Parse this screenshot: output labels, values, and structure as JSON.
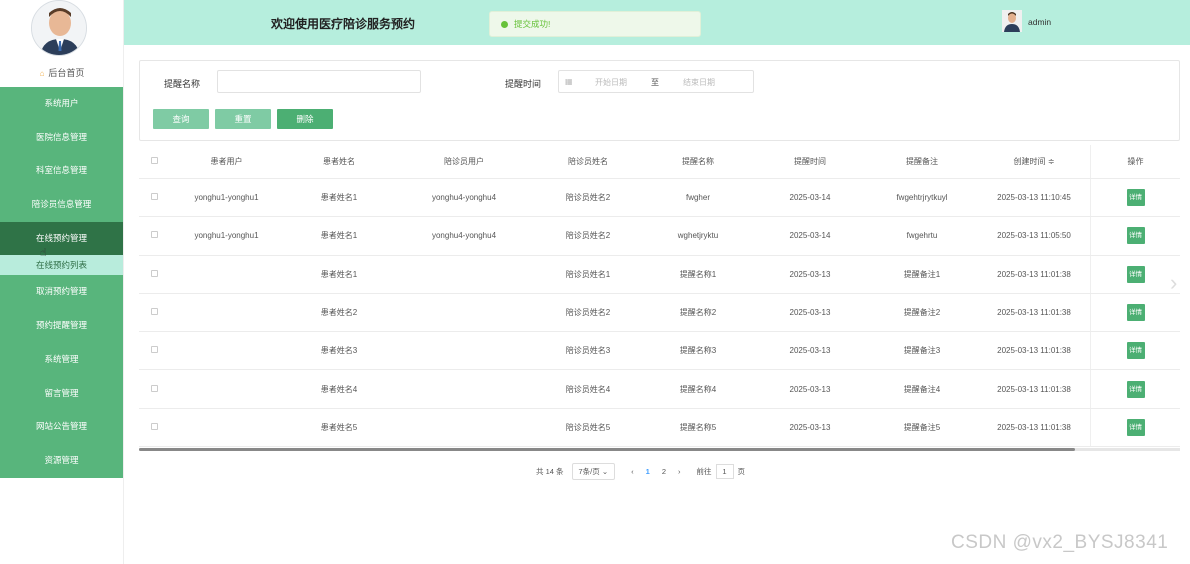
{
  "sidebar": {
    "home_label": "后台首页",
    "menu": [
      {
        "label": "系统用户"
      },
      {
        "label": "医院信息管理"
      },
      {
        "label": "科室信息管理"
      },
      {
        "label": "陪诊员信息管理"
      },
      {
        "label": "在线预约管理"
      },
      {
        "label": "取消预约管理"
      },
      {
        "label": "预约提醒管理"
      },
      {
        "label": "系统管理"
      },
      {
        "label": "留言管理"
      },
      {
        "label": "网站公告管理"
      },
      {
        "label": "资源管理"
      }
    ],
    "submenu_active": "在线预约列表"
  },
  "header": {
    "title": "欢迎使用医疗陪诊服务预约",
    "toast": "提交成功!",
    "username": "admin"
  },
  "search": {
    "name_label": "提醒名称",
    "time_label": "提醒时间",
    "start_placeholder": "开始日期",
    "to_label": "至",
    "end_placeholder": "结束日期",
    "query_btn": "查询",
    "reset_btn": "重置",
    "delete_btn": "删除"
  },
  "table": {
    "headers": [
      "患者用户",
      "患者姓名",
      "陪诊员用户",
      "陪诊员姓名",
      "提醒名称",
      "提醒时间",
      "提醒备注",
      "创建时间 ≑",
      "操作"
    ],
    "detail_label": "详情",
    "rows": [
      [
        "yonghu1-yonghu1",
        "患者姓名1",
        "yonghu4-yonghu4",
        "陪诊员姓名2",
        "fwgher",
        "2025-03-14",
        "fwgehtrjrytkuyl",
        "2025-03-13 11:10:45"
      ],
      [
        "yonghu1-yonghu1",
        "患者姓名1",
        "yonghu4-yonghu4",
        "陪诊员姓名2",
        "wghetjryktu",
        "2025-03-14",
        "fwgehrtu",
        "2025-03-13 11:05:50"
      ],
      [
        "",
        "患者姓名1",
        "",
        "陪诊员姓名1",
        "提醒名称1",
        "2025-03-13",
        "提醒备注1",
        "2025-03-13 11:01:38"
      ],
      [
        "",
        "患者姓名2",
        "",
        "陪诊员姓名2",
        "提醒名称2",
        "2025-03-13",
        "提醒备注2",
        "2025-03-13 11:01:38"
      ],
      [
        "",
        "患者姓名3",
        "",
        "陪诊员姓名3",
        "提醒名称3",
        "2025-03-13",
        "提醒备注3",
        "2025-03-13 11:01:38"
      ],
      [
        "",
        "患者姓名4",
        "",
        "陪诊员姓名4",
        "提醒名称4",
        "2025-03-13",
        "提醒备注4",
        "2025-03-13 11:01:38"
      ],
      [
        "",
        "患者姓名5",
        "",
        "陪诊员姓名5",
        "提醒名称5",
        "2025-03-13",
        "提醒备注5",
        "2025-03-13 11:01:38"
      ]
    ]
  },
  "pagination": {
    "total": "共 14 条",
    "page_size": "7条/页",
    "pages": [
      "1",
      "2"
    ],
    "current": "1",
    "goto_label": "前往",
    "goto_value": "1",
    "page_suffix": "页"
  },
  "watermark": "CSDN @vx2_BYSJ8341",
  "colors": {
    "sidebar_green": "#58b57c",
    "active_dark": "#2f7347",
    "header_mint": "#b6eedd",
    "button_green": "#4caf73"
  }
}
